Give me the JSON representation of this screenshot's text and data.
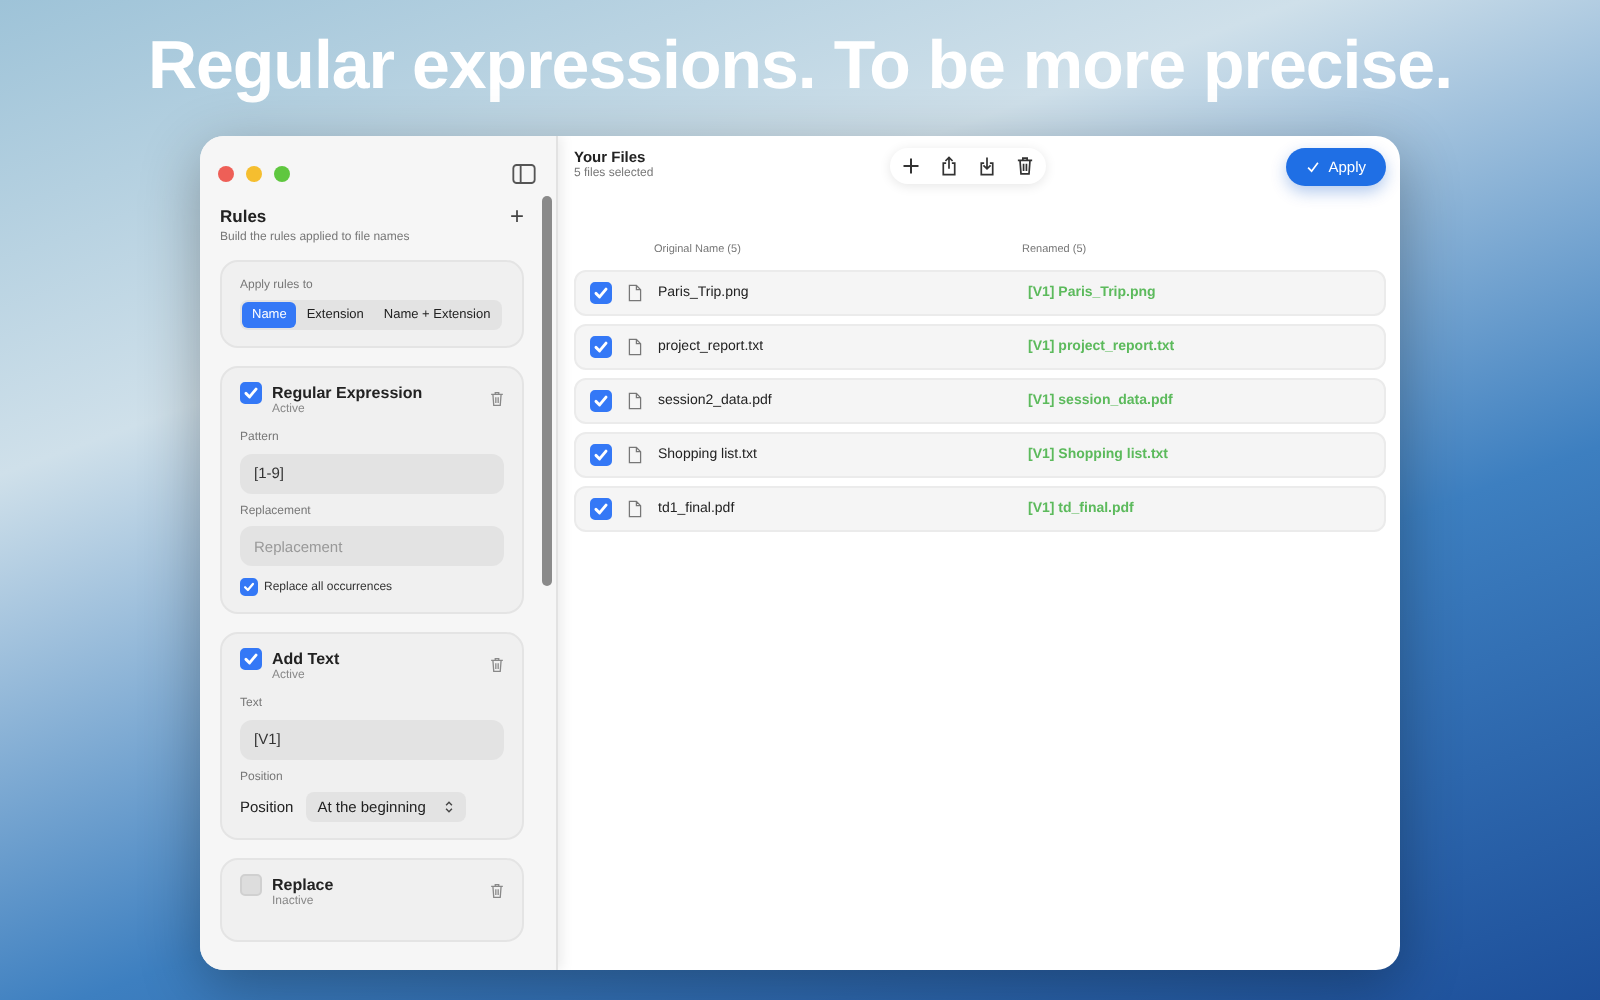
{
  "headline": "Regular expressions. To be more precise.",
  "sidebar": {
    "title": "Rules",
    "subtitle": "Build the rules applied to file names",
    "add_label": "+",
    "apply_to": {
      "label": "Apply rules to",
      "options": [
        {
          "label": "Name",
          "selected": true
        },
        {
          "label": "Extension",
          "selected": false
        },
        {
          "label": "Name + Extension",
          "selected": false
        }
      ]
    },
    "rules": [
      {
        "kind": "regex",
        "title": "Regular Expression",
        "status": "Active",
        "checked": true,
        "pattern_label": "Pattern",
        "pattern": "[1-9]",
        "replacement_label": "Replacement",
        "replacement_placeholder": "Replacement",
        "replace_all": {
          "label": "Replace all occurrences",
          "checked": true
        }
      },
      {
        "kind": "add_text",
        "title": "Add Text",
        "status": "Active",
        "checked": true,
        "text_label": "Text",
        "text": "[V1]",
        "position_label": "Position",
        "position_field_label": "Position",
        "position": "At the beginning"
      },
      {
        "kind": "replace",
        "title": "Replace",
        "status": "Inactive",
        "checked": false
      }
    ]
  },
  "files": {
    "title": "Your Files",
    "subtitle": "5 files selected",
    "apply_button": "Apply",
    "columns": [
      "Original Name (5)",
      "Renamed (5)"
    ],
    "rows": [
      {
        "checked": true,
        "original": "Paris_Trip.png",
        "renamed": "[V1] Paris_Trip.png"
      },
      {
        "checked": true,
        "original": "project_report.txt",
        "renamed": "[V1] project_report.txt"
      },
      {
        "checked": true,
        "original": "session2_data.pdf",
        "renamed": "[V1] session_data.pdf"
      },
      {
        "checked": true,
        "original": "Shopping list.txt",
        "renamed": "[V1] Shopping list.txt"
      },
      {
        "checked": true,
        "original": "td1_final.pdf",
        "renamed": "[V1] td_final.pdf"
      }
    ]
  }
}
